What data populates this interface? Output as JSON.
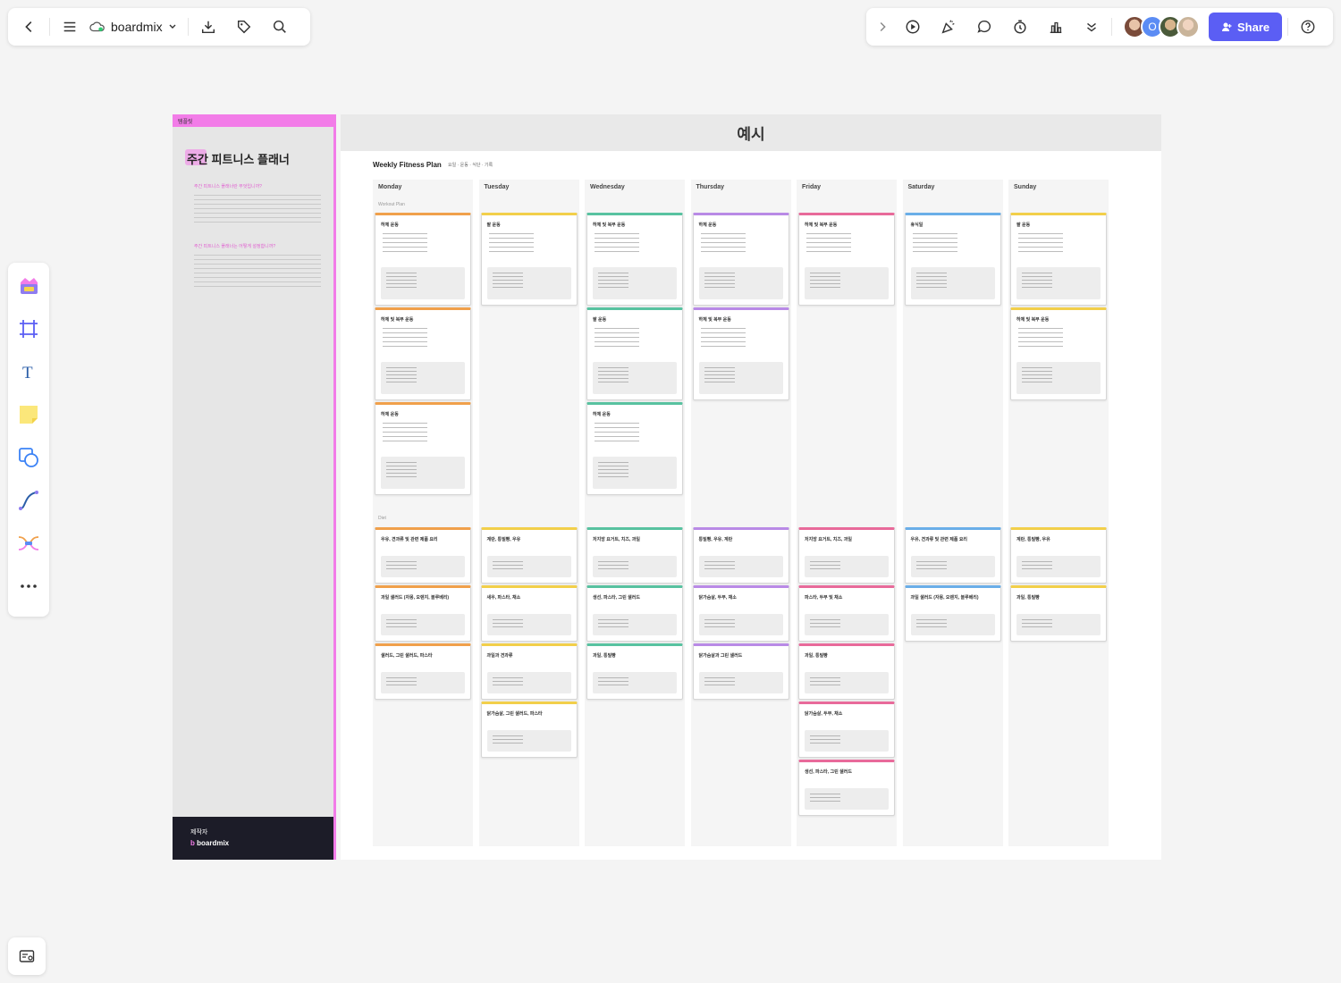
{
  "app": {
    "name": "boardmix"
  },
  "toolbar": {
    "share_label": "Share"
  },
  "board": {
    "side": {
      "top_label": "템플릿",
      "title": "주간 피트니스 플래너",
      "section1": "주간 피트니스 플래너란 무엇입니까?",
      "section2": "주간 피트니스 플래너는 어떻게 설정합니까?",
      "footer_small": "제작자",
      "footer_brand": "boardmix"
    },
    "main_title": "예시",
    "plan_title": "Weekly Fitness Plan",
    "plan_meta": "요일 · 운동 · 식단 · 기록",
    "section_workout": "Workout Plan",
    "section_diet": "Diet",
    "days": [
      "Monday",
      "Tuesday",
      "Wednesday",
      "Thursday",
      "Friday",
      "Saturday",
      "Sunday"
    ],
    "workout_cards": [
      [
        "하체 운동",
        "하체 및 복부 운동",
        "하체 운동"
      ],
      [
        "팔 운동"
      ],
      [
        "하체 및 복부 운동",
        "팔 운동",
        "하체 운동"
      ],
      [
        "하체 운동",
        "하체 및 복부 운동"
      ],
      [
        "하체 및 복부 운동"
      ],
      [
        "휴식일"
      ],
      [
        "팔 운동",
        "하체 및 복부 운동"
      ]
    ],
    "diet_cards": [
      [
        "우유, 견과류 및 관련 제품 요리",
        "과일 샐러드 (자몽, 오렌지, 블루베리)",
        "샐러드, 그린 샐러드, 파스타"
      ],
      [
        "계란, 통밀빵, 우유",
        "새우, 파스타, 채소",
        "과일과 견과류",
        "닭가슴살, 그린 샐러드, 파스타"
      ],
      [
        "저지방 요거트, 치즈, 과일",
        "생선, 파스타, 그린 샐러드",
        "과일, 통밀빵"
      ],
      [
        "통밀빵, 우유, 계란",
        "닭가슴살, 두부, 채소",
        "닭가슴살과 그린 샐러드"
      ],
      [
        "저지방 요거트, 치즈, 과일",
        "파스타, 두부 및 채소",
        "과일, 통밀빵",
        "닭가슴살, 두부, 채소",
        "생선, 파스타, 그린 샐러드"
      ],
      [
        "우유, 견과류 및 관련 제품 요리",
        "과일 샐러드 (자몽, 오렌지, 블루베리)"
      ],
      [
        "계란, 통밀빵, 우유",
        "과일, 통밀빵"
      ]
    ]
  },
  "colors": {
    "accent": "#5b5ef4",
    "side_pink": "#f27ce8",
    "day_colors": [
      "#f0a04b",
      "#f2cf4a",
      "#58c2a0",
      "#b98ae6",
      "#e86a9a",
      "#6aaee8",
      "#f2cf4a"
    ]
  },
  "icons": {
    "toolbar_left": [
      "back-icon",
      "menu-icon",
      "cloud-icon",
      "chevron-down-icon",
      "download-icon",
      "tag-icon",
      "search-icon"
    ],
    "toolbar_right": [
      "chevron-right-icon",
      "play-icon",
      "celebrate-icon",
      "comment-icon",
      "timer-icon",
      "vote-icon",
      "more-down-icon",
      "help-icon"
    ],
    "palette": [
      "template-icon",
      "frame-icon",
      "text-icon",
      "sticky-note-icon",
      "shape-icon",
      "connector-icon",
      "mindmap-icon",
      "more-icon"
    ]
  }
}
